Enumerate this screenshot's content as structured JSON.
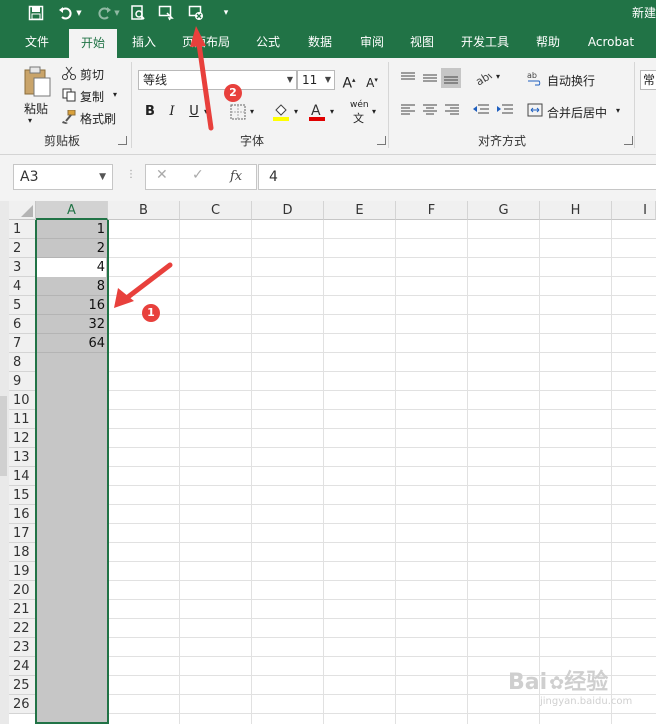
{
  "title_bar": {
    "doc_title": "新建",
    "quick_access": [
      "save-icon",
      "undo-icon",
      "redo-icon",
      "print-preview-icon",
      "touch-mode-icon",
      "custom-macro-icon",
      "customize-qat-icon"
    ]
  },
  "tabs": [
    "文件",
    "开始",
    "插入",
    "页面布局",
    "公式",
    "数据",
    "审阅",
    "视图",
    "开发工具",
    "帮助",
    "Acrobat"
  ],
  "ribbon": {
    "clipboard": {
      "paste": "粘贴",
      "cut": "剪切",
      "copy": "复制",
      "format_painter": "格式刷",
      "label": "剪贴板"
    },
    "font": {
      "font_name": "等线",
      "font_size": "11",
      "bold": "B",
      "italic": "I",
      "underline": "U",
      "phonetic": "wén",
      "phonetic_sub": "文",
      "label": "字体"
    },
    "alignment": {
      "wrap": "自动换行",
      "merge": "合并后居中",
      "label": "对齐方式"
    },
    "number": {
      "format_partial": "常"
    }
  },
  "formula_bar": {
    "name_box": "A3",
    "cancel": "✕",
    "enter": "✓",
    "fx": "fx",
    "content": "4"
  },
  "grid": {
    "columns": [
      "A",
      "B",
      "C",
      "D",
      "E",
      "F",
      "G",
      "H",
      "I"
    ],
    "rows": [
      "1",
      "2",
      "3",
      "4",
      "5",
      "6",
      "7",
      "8",
      "9",
      "10",
      "11",
      "12",
      "13",
      "14",
      "15",
      "16",
      "17",
      "18",
      "19",
      "20",
      "21",
      "22",
      "23",
      "24",
      "25",
      "26"
    ],
    "column_a_values": [
      "1",
      "2",
      "4",
      "8",
      "16",
      "32",
      "64"
    ]
  },
  "annotations": {
    "badge1": "1",
    "badge2": "2",
    "accent": "#e8403c"
  },
  "watermark": {
    "text": "Bai",
    "text2": "经验",
    "sub": "jingyan.baidu.com"
  },
  "colors": {
    "excel_green": "#217346",
    "ribbon_bg": "#f3f3f3",
    "selection_gray": "#c6c6c6"
  }
}
